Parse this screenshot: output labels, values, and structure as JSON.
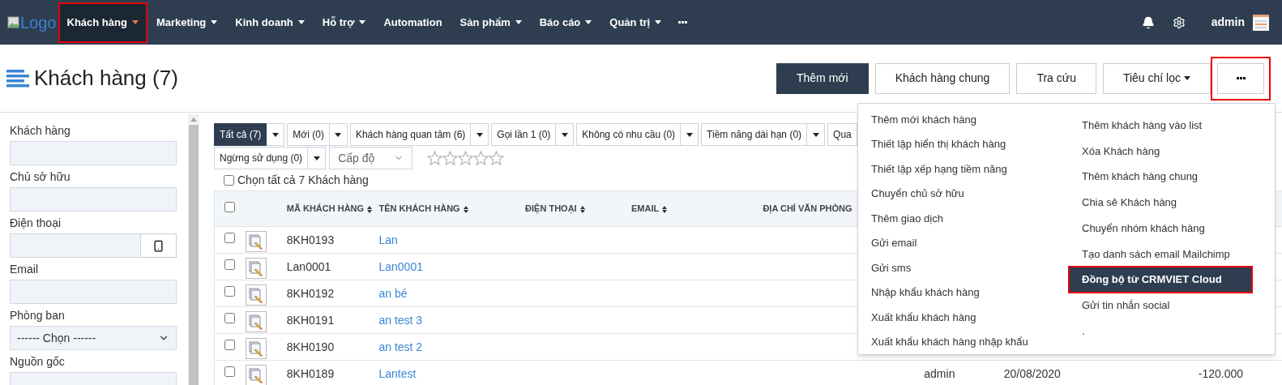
{
  "navbar": {
    "logo": "Logo",
    "items": [
      {
        "label": "Khách hàng",
        "has_caret": true,
        "selected": true,
        "annotated": true
      },
      {
        "label": "Marketing",
        "has_caret": true,
        "selected": false,
        "annotated": false
      },
      {
        "label": "Kinh doanh",
        "has_caret": true,
        "selected": false,
        "annotated": false
      },
      {
        "label": "Hỗ trợ",
        "has_caret": true,
        "selected": false,
        "annotated": false
      },
      {
        "label": "Automation",
        "has_caret": false,
        "selected": false,
        "annotated": false
      },
      {
        "label": "Sản phẩm",
        "has_caret": true,
        "selected": false,
        "annotated": false
      },
      {
        "label": "Báo cáo",
        "has_caret": true,
        "selected": false,
        "annotated": false
      },
      {
        "label": "Quản trị",
        "has_caret": true,
        "selected": false,
        "annotated": false
      }
    ],
    "user": "admin"
  },
  "page": {
    "title": "Khách hàng (7)",
    "actions": [
      {
        "label": "Thêm mới",
        "kind": "primary",
        "annotated": false
      },
      {
        "label": "Khách hàng chung",
        "kind": "plain",
        "annotated": false
      },
      {
        "label": "Tra cứu",
        "kind": "plain",
        "annotated": false
      },
      {
        "label": "Tiêu chí lọc",
        "kind": "dropdown",
        "annotated": false
      },
      {
        "kind": "more",
        "annotated": true
      }
    ]
  },
  "sidebar": {
    "fields": [
      {
        "label": "Khách hàng",
        "kind": "text"
      },
      {
        "label": "Chủ sở hữu",
        "kind": "text"
      },
      {
        "label": "Điện thoại",
        "kind": "phone"
      },
      {
        "label": "Email",
        "kind": "text"
      },
      {
        "label": "Phòng ban",
        "kind": "select",
        "value": "------ Chọn ------"
      },
      {
        "label": "Nguồn gốc",
        "kind": "text"
      }
    ]
  },
  "filters": [
    {
      "label": "Tất cả (7)",
      "selected": true,
      "has_dropdown": true
    },
    {
      "label": "Mới (0)",
      "selected": false,
      "has_dropdown": true
    },
    {
      "label": "Khách hàng quan tâm (6)",
      "selected": false,
      "has_dropdown": true
    },
    {
      "label": "Gọi lần 1 (0)",
      "selected": false,
      "has_dropdown": true
    },
    {
      "label": "Không có nhu cầu (0)",
      "selected": false,
      "has_dropdown": true
    },
    {
      "label": "Tiềm năng dài hạn (0)",
      "selected": false,
      "has_dropdown": true
    },
    {
      "label": "Qua",
      "selected": false,
      "has_dropdown": false
    },
    {
      "label": "Ngừng sử dụng (0)",
      "selected": false,
      "has_dropdown": true
    }
  ],
  "level_select": {
    "placeholder": "Cấp độ"
  },
  "rating": {
    "stars": 0
  },
  "select_all": {
    "label": "Chọn tất cả 7 Khách hàng",
    "checked": false
  },
  "table": {
    "columns": [
      "MÃ KHÁCH HÀNG",
      "TÊN KHÁCH HÀNG",
      "ĐIỆN THOẠI",
      "EMAIL",
      "ĐỊA CHỈ VĂN PHÒNG"
    ],
    "header_checked": false,
    "rows": [
      {
        "code": "8KH0193",
        "name": "Lan",
        "checked": false
      },
      {
        "code": "Lan0001",
        "name": "Lan0001",
        "checked": false
      },
      {
        "code": "8KH0192",
        "name": "an bé",
        "checked": false
      },
      {
        "code": "8KH0191",
        "name": "an test 3",
        "checked": false
      },
      {
        "code": "8KH0190",
        "name": "an test 2",
        "checked": false
      },
      {
        "code": "8KH0189",
        "name": "Lantest",
        "checked": false,
        "owner": "admin",
        "date": "20/08/2020",
        "amount": "-120.000"
      }
    ]
  },
  "more_menu": {
    "columns": [
      {
        "items": [
          {
            "label": "Thêm mới khách hàng",
            "selected": false,
            "annotated": false
          },
          {
            "label": "Thiết lập hiển thị khách hàng",
            "selected": false,
            "annotated": false
          },
          {
            "label": "Thiết lập xếp hạng tiềm năng",
            "selected": false,
            "annotated": false
          },
          {
            "label": "Chuyển chủ sở hữu",
            "selected": false,
            "annotated": false
          },
          {
            "label": "Thêm giao dịch",
            "selected": false,
            "annotated": false
          },
          {
            "label": "Gửi email",
            "selected": false,
            "annotated": false
          },
          {
            "label": "Gửi sms",
            "selected": false,
            "annotated": false
          },
          {
            "label": "Nhập khẩu khách hàng",
            "selected": false,
            "annotated": false
          },
          {
            "label": "Xuất khẩu khách hàng",
            "selected": false,
            "annotated": false
          },
          {
            "label": "Xuất khẩu khách hàng nhập khẩu",
            "selected": false,
            "annotated": false
          }
        ]
      },
      {
        "items": [
          {
            "label": "Thêm khách hàng vào list",
            "selected": false,
            "annotated": false
          },
          {
            "label": "Xóa Khách hàng",
            "selected": false,
            "annotated": false
          },
          {
            "label": "Thêm khách hàng chung",
            "selected": false,
            "annotated": false
          },
          {
            "label": "Chia sẻ Khách hàng",
            "selected": false,
            "annotated": false
          },
          {
            "label": "Chuyển nhóm khách hàng",
            "selected": false,
            "annotated": false
          },
          {
            "label": "Tạo danh sách email Mailchimp",
            "selected": false,
            "annotated": false
          },
          {
            "label": "Đồng bộ từ CRMVIET Cloud",
            "selected": true,
            "annotated": true
          },
          {
            "label": "Gửi tin nhắn social",
            "selected": false,
            "annotated": false
          },
          {
            "label": ".",
            "selected": false,
            "annotated": false
          }
        ]
      }
    ]
  }
}
